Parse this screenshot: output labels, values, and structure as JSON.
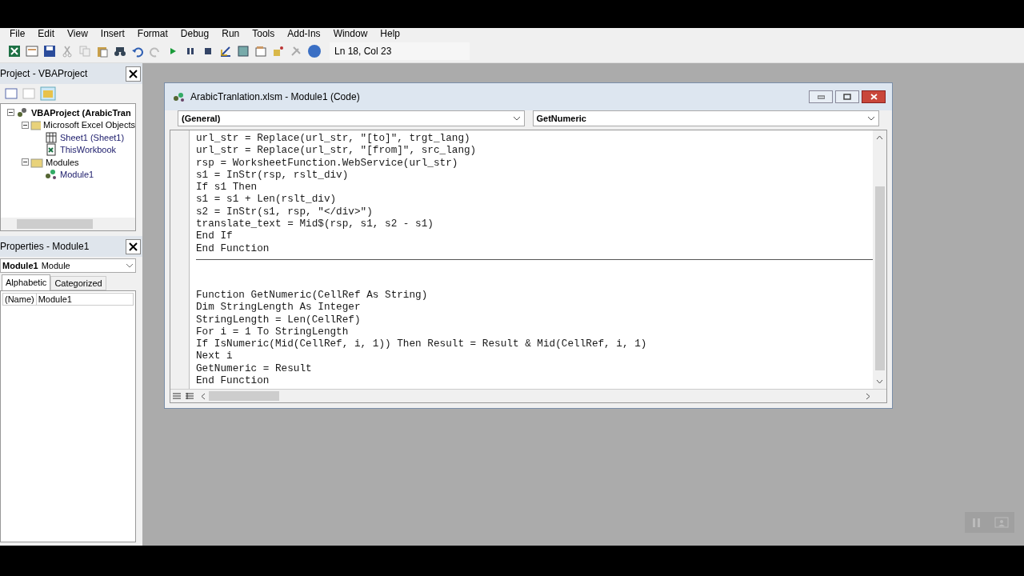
{
  "menu": [
    "File",
    "Edit",
    "View",
    "Insert",
    "Format",
    "Debug",
    "Run",
    "Tools",
    "Add-Ins",
    "Window",
    "Help"
  ],
  "toolbar": {
    "position": "Ln 18, Col 23"
  },
  "project_panel": {
    "title": "Project - VBAProject",
    "tree": [
      {
        "label": "VBAProject (ArabicTran",
        "kind": "project",
        "expanded": true,
        "children": [
          {
            "label": "Microsoft Excel Objects",
            "kind": "folder",
            "expanded": true,
            "children": [
              {
                "label": "Sheet1 (Sheet1)",
                "kind": "sheet"
              },
              {
                "label": "ThisWorkbook",
                "kind": "workbook"
              }
            ]
          },
          {
            "label": "Modules",
            "kind": "folder",
            "expanded": true,
            "children": [
              {
                "label": "Module1",
                "kind": "module"
              }
            ]
          }
        ]
      }
    ]
  },
  "properties_panel": {
    "title": "Properties - Module1",
    "object_name": "Module1",
    "object_type": "Module",
    "tabs": [
      {
        "label": "Alphabetic",
        "selected": true
      },
      {
        "label": "Categorized",
        "selected": false
      }
    ],
    "rows": [
      {
        "name": "(Name)",
        "value": "Module1"
      }
    ]
  },
  "code_window": {
    "title": "ArabicTranlation.xlsm - Module1 (Code)",
    "object_dropdown": "(General)",
    "procedure_dropdown": "GetNumeric",
    "procedures": [
      {
        "lines": [
          "url_str = Replace(url_str, \"[to]\", trgt_lang)",
          "url_str = Replace(url_str, \"[from]\", src_lang)",
          "rsp = WorksheetFunction.WebService(url_str)",
          "s1 = InStr(rsp, rslt_div)",
          "If s1 Then",
          "s1 = s1 + Len(rslt_div)",
          "s2 = InStr(s1, rsp, \"</div>\")",
          "translate_text = Mid$(rsp, s1, s2 - s1)",
          "End If",
          "End Function"
        ]
      },
      {
        "lines": [
          "Function GetNumeric(CellRef As String)",
          "Dim StringLength As Integer",
          "StringLength = Len(CellRef)",
          "For i = 1 To StringLength",
          "If IsNumeric(Mid(CellRef, i, 1)) Then Result = Result & Mid(CellRef, i, 1)",
          "Next i",
          "GetNumeric = Result",
          "End Function"
        ]
      }
    ]
  }
}
